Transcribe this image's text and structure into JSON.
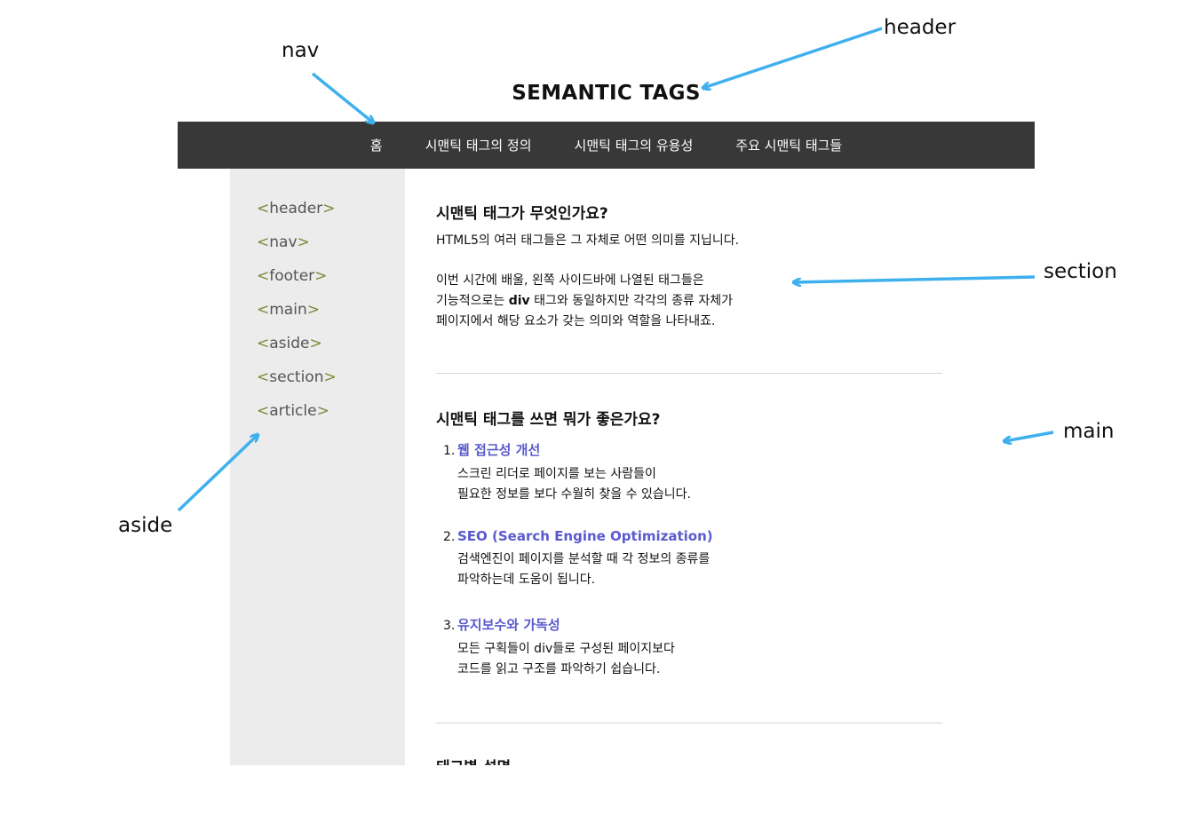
{
  "header": {
    "title": "SEMANTIC TAGS"
  },
  "nav": {
    "items": [
      "홈",
      "시맨틱 태그의 정의",
      "시맨틱 태그의 유용성",
      "주요 시맨틱 태그들"
    ]
  },
  "aside": {
    "items": [
      {
        "tag": "header"
      },
      {
        "tag": "nav"
      },
      {
        "tag": "footer"
      },
      {
        "tag": "main"
      },
      {
        "tag": "aside"
      },
      {
        "tag": "section"
      },
      {
        "tag": "article"
      }
    ],
    "open": "<",
    "close": ">"
  },
  "section1": {
    "heading": "시맨틱 태그가 무엇인가요?",
    "p1": "HTML5의 여러 태그들은 그 자체로 어떤 의미를 지닙니다.",
    "p2_line1": "이번 시간에 배울, 왼쪽 사이드바에 나열된 태그들은",
    "p2_line2_pre": "기능적으로는 ",
    "p2_line2_bold": "div",
    "p2_line2_post": " 태그와 동일하지만 각각의 종류 자체가",
    "p2_line3": "페이지에서 해당 요소가 갖는 의미와 역할을 나타내죠."
  },
  "section2": {
    "heading": "시맨틱 태그를 쓰면 뭐가 좋은가요?",
    "items": [
      {
        "num": "1.",
        "title": "웹 접근성 개선",
        "line1": "스크린 리더로 페이지를 보는 사람들이",
        "line2": "필요한 정보를 보다 수월히 찾을 수 있습니다."
      },
      {
        "num": "2.",
        "title": "SEO (Search Engine Optimization)",
        "line1": "검색엔진이 페이지를 분석할 때 각 정보의 종류를",
        "line2": "파악하는데 도움이 됩니다."
      },
      {
        "num": "3.",
        "title": "유지보수와 가독성",
        "line1": "모든 구획들이 div들로 구성된 페이지보다",
        "line2": "코드를 읽고 구조를 파악하기 쉽습니다."
      }
    ]
  },
  "section3": {
    "heading": "태그별 설명"
  },
  "annotations": {
    "header": "header",
    "nav": "nav",
    "section": "section",
    "main": "main",
    "aside": "aside"
  },
  "colors": {
    "arrow": "#3fb0ee",
    "nav_bg": "#383838",
    "aside_bg": "#ececec",
    "link": "#5a5acf"
  }
}
